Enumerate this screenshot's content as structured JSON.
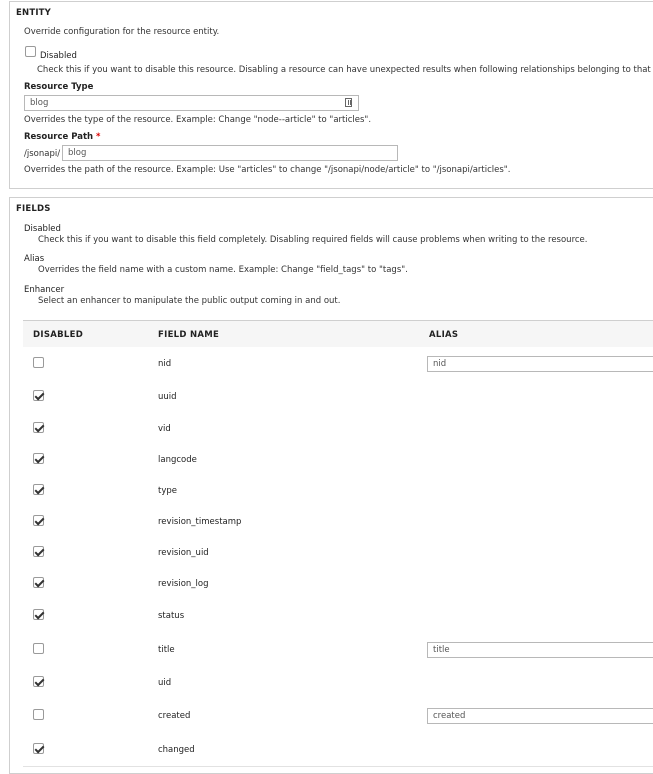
{
  "entity": {
    "legend": "ENTITY",
    "description": "Override configuration for the resource entity.",
    "disabled_label": "Disabled",
    "disabled_help": "Check this if you want to disable this resource. Disabling a resource can have unexpected results when following relationships belonging to that",
    "resource_type_label": "Resource Type",
    "resource_type_value": "blog",
    "resource_type_help": "Overrides the type of the resource. Example: Change \"node--article\" to \"articles\".",
    "resource_path_label": "Resource Path",
    "required_mark": "*",
    "path_prefix": "/jsonapi/",
    "resource_path_value": "blog",
    "resource_path_help": "Overrides the path of the resource. Example: Use \"articles\" to change \"/jsonapi/node/article\" to \"/jsonapi/articles\"."
  },
  "fields": {
    "legend": "FIELDS",
    "disabled_title": "Disabled",
    "disabled_desc": "Check this if you want to disable this field completely. Disabling required fields will cause problems when writing to the resource.",
    "alias_title": "Alias",
    "alias_desc": "Overrides the field name with a custom name. Example: Change \"field_tags\" to \"tags\".",
    "enhancer_title": "Enhancer",
    "enhancer_desc": "Select an enhancer to manipulate the public output coming in and out.",
    "columns": {
      "disabled": "DISABLED",
      "field_name": "FIELD NAME",
      "alias": "ALIAS"
    },
    "rows": [
      {
        "name": "nid",
        "checked": false,
        "alias": "nid"
      },
      {
        "name": "uuid",
        "checked": true,
        "alias": null
      },
      {
        "name": "vid",
        "checked": true,
        "alias": null
      },
      {
        "name": "langcode",
        "checked": true,
        "alias": null
      },
      {
        "name": "type",
        "checked": true,
        "alias": null
      },
      {
        "name": "revision_timestamp",
        "checked": true,
        "alias": null
      },
      {
        "name": "revision_uid",
        "checked": true,
        "alias": null
      },
      {
        "name": "revision_log",
        "checked": true,
        "alias": null
      },
      {
        "name": "status",
        "checked": true,
        "alias": null
      },
      {
        "name": "title",
        "checked": false,
        "alias": "title"
      },
      {
        "name": "uid",
        "checked": true,
        "alias": null
      },
      {
        "name": "created",
        "checked": false,
        "alias": "created"
      },
      {
        "name": "changed",
        "checked": true,
        "alias": null
      }
    ]
  }
}
